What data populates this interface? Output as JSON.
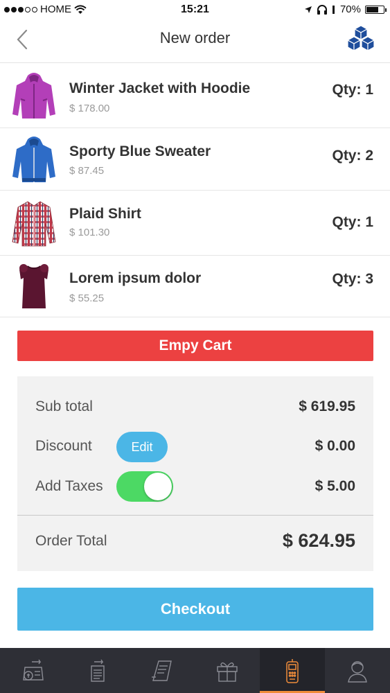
{
  "status_bar": {
    "carrier": "HOME",
    "time": "15:21",
    "battery": "70%",
    "battery_level": 0.7
  },
  "nav": {
    "title": "New order",
    "logo_icon": "cube-cluster-icon"
  },
  "items": [
    {
      "name": "Winter Jacket with Hoodie",
      "price": "$ 178.00",
      "qty": "Qty: 1",
      "image": "purple-jacket-image",
      "color": "#b33fb8"
    },
    {
      "name": "Sporty Blue Sweater",
      "price": "$ 87.45",
      "qty": "Qty: 2",
      "image": "blue-sweater-image",
      "color": "#2e6cc7"
    },
    {
      "name": "Plaid Shirt",
      "price": "$ 101.30",
      "qty": "Qty: 1",
      "image": "plaid-shirt-image",
      "color": "#c0394a"
    },
    {
      "name": "Lorem ipsum dolor",
      "price": "$ 55.25",
      "qty": "Qty: 3",
      "image": "maroon-blouse-image",
      "color": "#5a1530"
    }
  ],
  "empty_cart_label": "Empy Cart",
  "summary": {
    "subtotal_label": "Sub total",
    "subtotal_value": "$ 619.95",
    "discount_label": "Discount",
    "discount_edit": "Edit",
    "discount_value": "$ 0.00",
    "taxes_label": "Add Taxes",
    "taxes_value": "$ 5.00",
    "taxes_enabled": true,
    "total_label": "Order Total",
    "total_value": "$ 624.95"
  },
  "checkout_label": "Checkout",
  "tabs": [
    {
      "icon": "cash-register-icon",
      "active": false
    },
    {
      "icon": "transfer-documents-icon",
      "active": false
    },
    {
      "icon": "receipt-icon",
      "active": false
    },
    {
      "icon": "gift-icon",
      "active": false
    },
    {
      "icon": "pos-terminal-icon",
      "active": true
    },
    {
      "icon": "customer-icon",
      "active": false
    }
  ],
  "colors": {
    "accent_blue": "#4bb6e6",
    "danger_red": "#ec4141",
    "toggle_green": "#4cd964",
    "tab_active": "#f08c3a",
    "tab_bar": "#2e2f36",
    "logo_blue": "#1f4e9c"
  }
}
